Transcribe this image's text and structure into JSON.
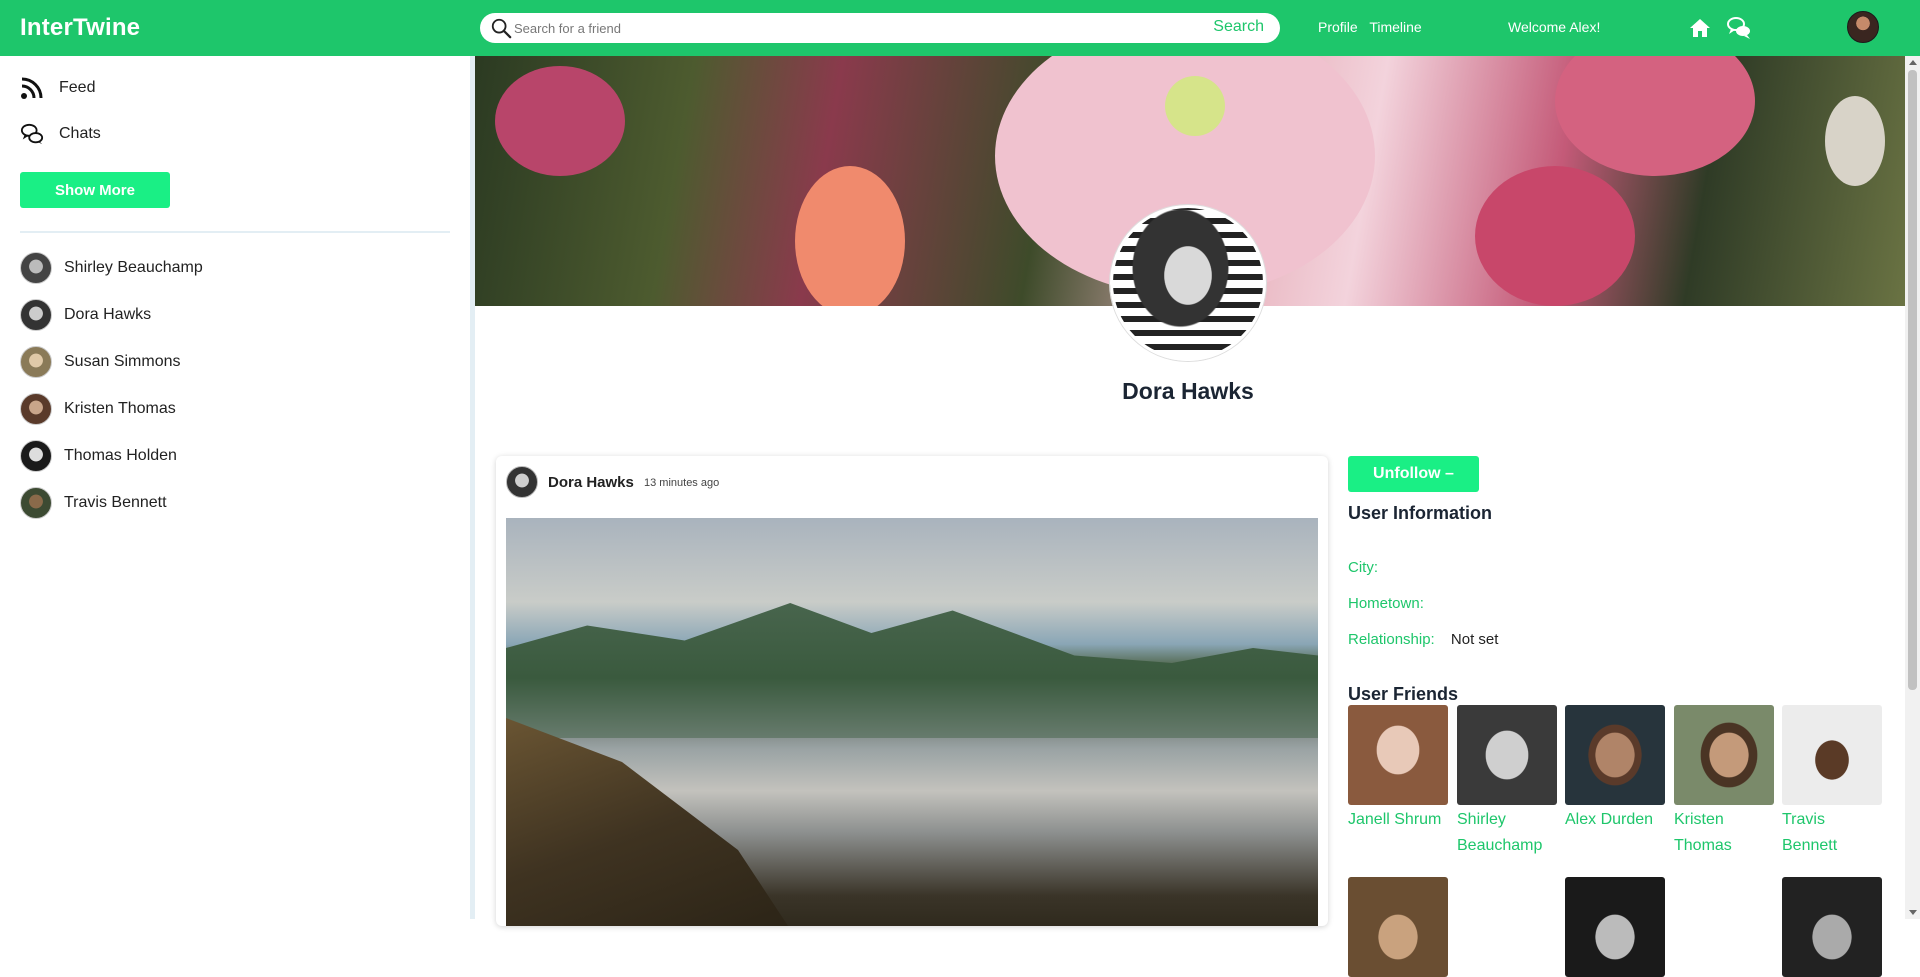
{
  "app": {
    "logo": "InterTwine"
  },
  "header": {
    "search_placeholder": "Search for a friend",
    "search_button": "Search",
    "nav": [
      "Profile",
      "Timeline"
    ],
    "welcome": "Welcome Alex!"
  },
  "sidebar": {
    "menu": [
      {
        "label": "Feed",
        "icon": "rss-icon"
      },
      {
        "label": "Chats",
        "icon": "chat-icon"
      }
    ],
    "show_more": "Show More",
    "friends": [
      {
        "name": "Shirley Beauchamp"
      },
      {
        "name": "Dora Hawks"
      },
      {
        "name": "Susan Simmons"
      },
      {
        "name": "Kristen Thomas"
      },
      {
        "name": "Thomas Holden"
      },
      {
        "name": "Travis Bennett"
      }
    ]
  },
  "profile": {
    "name": "Dora Hawks",
    "unfollow": "Unfollow  –",
    "info_title": "User Information",
    "info": {
      "city_label": "City:",
      "hometown_label": "Hometown:",
      "relationship_label": "Relationship:",
      "relationship_value": "Not set"
    },
    "friends_title": "User Friends",
    "friends": [
      {
        "first": "Janell Shrum",
        "last": ""
      },
      {
        "first": "Shirley",
        "last": "Beauchamp"
      },
      {
        "first": "Alex Durden",
        "last": ""
      },
      {
        "first": "Kristen",
        "last": "Thomas"
      },
      {
        "first": "Travis",
        "last": "Bennett"
      }
    ]
  },
  "post": {
    "author": "Dora Hawks",
    "time": "13 minutes ago"
  },
  "colors": {
    "brand": "#1ec66b",
    "button": "#1aef85"
  }
}
